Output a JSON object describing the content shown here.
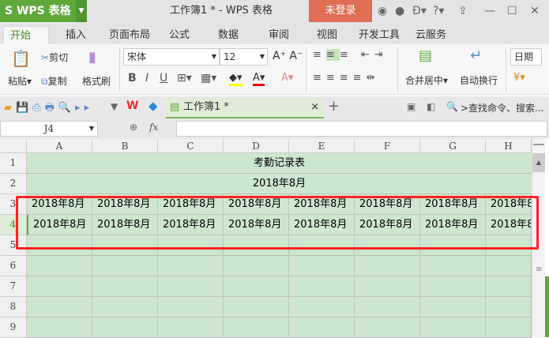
{
  "titlebar": {
    "app": "WPS 表格",
    "document_title": "工作簿1 * - WPS 表格",
    "login": "未登录"
  },
  "ribbon_tabs": [
    "开始",
    "插入",
    "页面布局",
    "公式",
    "数据",
    "审阅",
    "视图",
    "开发工具",
    "云服务"
  ],
  "ribbon": {
    "paste": "粘贴",
    "cut": "剪切",
    "copy": "复制",
    "format_painter": "格式刷",
    "font_name": "宋体",
    "font_size": "12",
    "merge_center": "合并居中",
    "wrap_text": "自动换行",
    "number_format": "日期"
  },
  "doc_tab": {
    "label": "工作簿1 *"
  },
  "search": {
    "placeholder": ">查找命令、搜索..."
  },
  "formula_bar": {
    "name_box": "J4",
    "fx": "fx",
    "value": ""
  },
  "columns": [
    "A",
    "B",
    "C",
    "D",
    "E",
    "F",
    "G",
    "H"
  ],
  "rows": [
    "1",
    "2",
    "3",
    "4",
    "5",
    "6",
    "7",
    "8",
    "9"
  ],
  "sheet": {
    "title": "考勤记录表",
    "subtitle": "2018年8月",
    "row3": [
      "2018年8月",
      "2018年8月",
      "2018年8月",
      "2018年8月",
      "2018年8月",
      "2018年8月",
      "2018年8月",
      "2018年8"
    ],
    "row4": [
      "2018年8月",
      "2018年8月",
      "2018年8月",
      "2018年8月",
      "2018年8月",
      "2018年8月",
      "2018年8月",
      "2018年8"
    ]
  },
  "colors": {
    "accent": "#5fa83c",
    "login": "#e06e55",
    "cell_bg": "#cde7cf",
    "highlight": "#ff2222"
  }
}
